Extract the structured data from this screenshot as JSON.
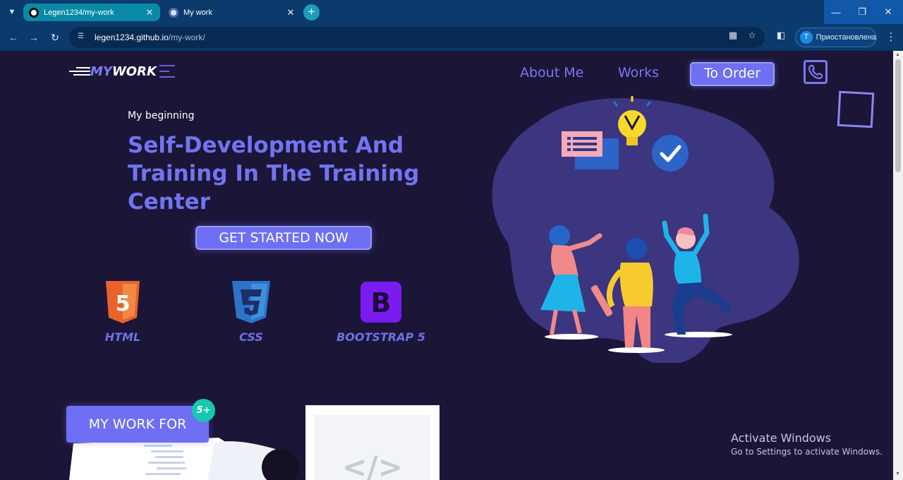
{
  "browser": {
    "tabs": [
      {
        "label": "Legen1234/my-work",
        "active": true
      },
      {
        "label": "My work",
        "active": false
      }
    ],
    "address": {
      "host": "legen1234.github.io",
      "path": "/my-work/"
    },
    "profile": {
      "initial": "T",
      "label": "Приостановлена"
    },
    "icons": {
      "tab_menu": "chevron-down-icon",
      "new_tab": "plus-icon",
      "back": "arrow-left-icon",
      "forward": "arrow-right-icon",
      "reload": "reload-icon",
      "site_info": "tune-icon",
      "translate": "translate-icon",
      "bookmark": "star-icon",
      "side_panel": "side-panel-icon",
      "menu": "kebab-icon"
    }
  },
  "site": {
    "logo": {
      "my": "MY",
      "work": "WORK"
    },
    "nav": {
      "about": "About Me",
      "works": "Works",
      "order": "To Order"
    },
    "hero": {
      "eyebrow": "My beginning",
      "title": "Self-Development And Training In The Training Center",
      "cta": "GET STARTED NOW"
    },
    "tech": [
      {
        "label": "HTML",
        "icon": "html5-icon",
        "glyph": "5",
        "color": "#e8622a"
      },
      {
        "label": "CSS",
        "icon": "css3-icon",
        "glyph": "3",
        "color": "#2c73c9"
      },
      {
        "label": "BOOTSTRAP 5",
        "icon": "bootstrap-icon",
        "glyph": "B",
        "color": "#7a1bf2"
      }
    ],
    "work_for": {
      "label": "MY WORK FOR",
      "badge": "5+"
    }
  },
  "os_watermark": {
    "title": "Activate Windows",
    "subtitle": "Go to Settings to activate Windows."
  },
  "colors": {
    "accent": "#6e6ff2",
    "background": "#1b1538",
    "chrome": "#0b3a6d",
    "teal": "#17c7b0"
  }
}
